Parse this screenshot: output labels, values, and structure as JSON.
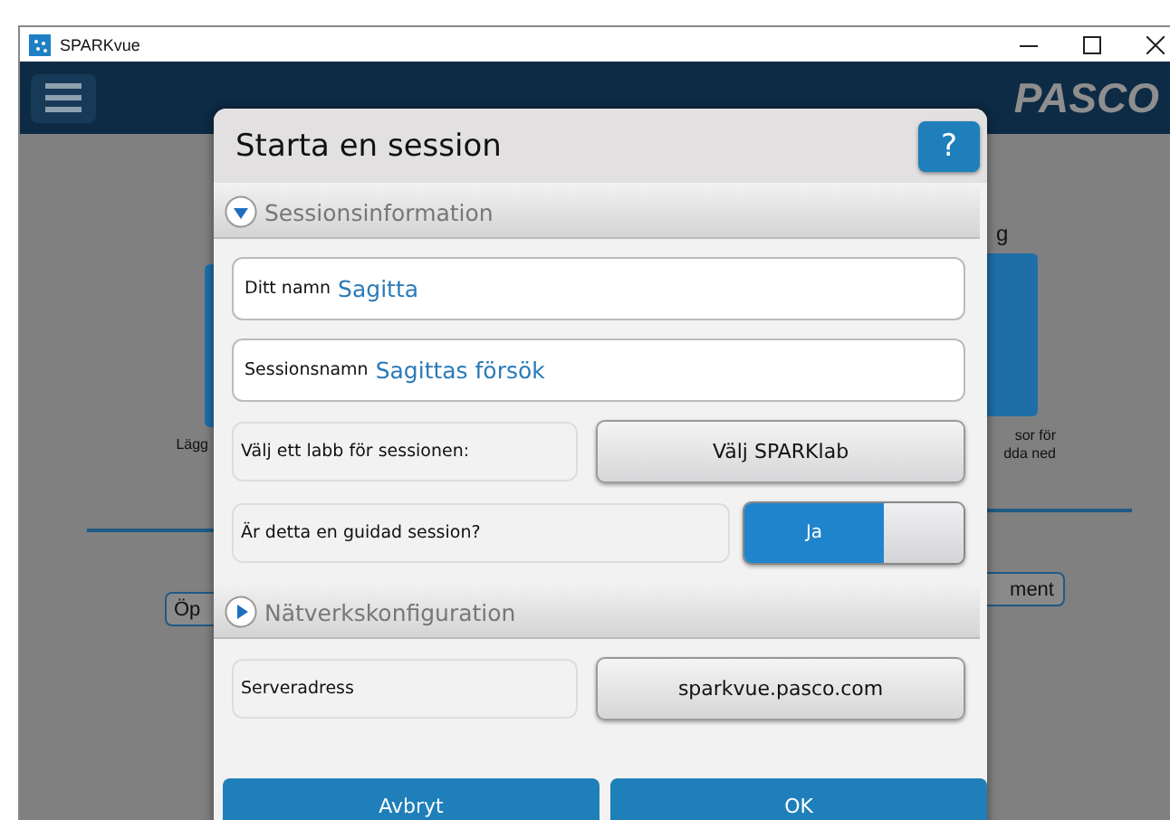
{
  "window": {
    "title": "SPARKvue"
  },
  "header": {
    "logo": "PASCO"
  },
  "background": {
    "left": {
      "tile_caption": "Lägg",
      "button": "Öp"
    },
    "right": {
      "heading": "g",
      "tile_caption": [
        "sor för",
        "dda ned"
      ],
      "button": "ment"
    }
  },
  "dialog": {
    "title": "Starta en session",
    "help_button": "?",
    "sections": [
      {
        "title": "Sessionsinformation",
        "expanded": true,
        "rows": [
          {
            "kind": "field",
            "label": "Ditt namn",
            "value": "Sagitta"
          },
          {
            "kind": "field",
            "label": "Sessionsnamn",
            "value": "Sagittas försök"
          },
          {
            "kind": "button",
            "label": "Välj ett labb för sessionen:",
            "button": "Välj SPARKlab"
          },
          {
            "kind": "toggle",
            "label": "Är detta en guidad session?",
            "toggle_label": "Ja",
            "on": true
          }
        ]
      },
      {
        "title": "Nätverkskonfiguration",
        "expanded": false,
        "rows": [
          {
            "kind": "button",
            "label": "Serveradress",
            "button": "sparkvue.pasco.com"
          }
        ]
      }
    ],
    "buttons": [
      "Avbryt",
      "OK"
    ]
  }
}
